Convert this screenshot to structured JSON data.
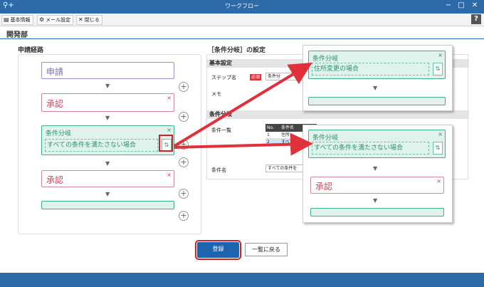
{
  "window": {
    "title": "ワークフロー",
    "minimize": "−",
    "maximize": "□",
    "close": "✕",
    "app_icon": "search-plus-icon"
  },
  "toolbar": {
    "basic_info": "基本情報",
    "mail_settings": "メール設定",
    "close_label": "閉じる",
    "help": "?"
  },
  "page": {
    "heading": "開発部"
  },
  "route": {
    "title": "申請経路",
    "apply": "申請",
    "approve1": "承認",
    "branch_label": "条件分岐",
    "branch_condition": "すべての条件を満たさない場合",
    "approve2": "承認",
    "close": "×",
    "sort": "⇅",
    "plus": "+"
  },
  "settings": {
    "title": "［条件分岐］の設定",
    "basic_header": "基本設定",
    "step_name_label": "ステップ名",
    "required_badge": "必須",
    "step_name_value": "条件分",
    "memo_label": "メモ",
    "condition_header": "条件分岐",
    "condition_list_label": "条件一覧",
    "table_no": "No.",
    "table_name": "条件名",
    "row1_no": "1",
    "row1_name": "住所",
    "row2_no": "2",
    "row2_name": "すべての",
    "condition_name_label": "条件名",
    "condition_name_value": "すべての条件を"
  },
  "overlay1": {
    "branch_label": "条件分岐",
    "condition": "住所変更の場合",
    "close": "×"
  },
  "overlay2": {
    "branch_label": "条件分岐",
    "condition": "すべての条件を満たさない場合",
    "approve": "承認",
    "close": "×"
  },
  "buttons": {
    "register": "登録",
    "back_to_list": "一覧に戻る"
  },
  "colors": {
    "titlebar": "#2e6aa8",
    "accent_green": "#3fae8a",
    "accent_red": "#d0202c",
    "primary_button": "#1e63b0"
  }
}
